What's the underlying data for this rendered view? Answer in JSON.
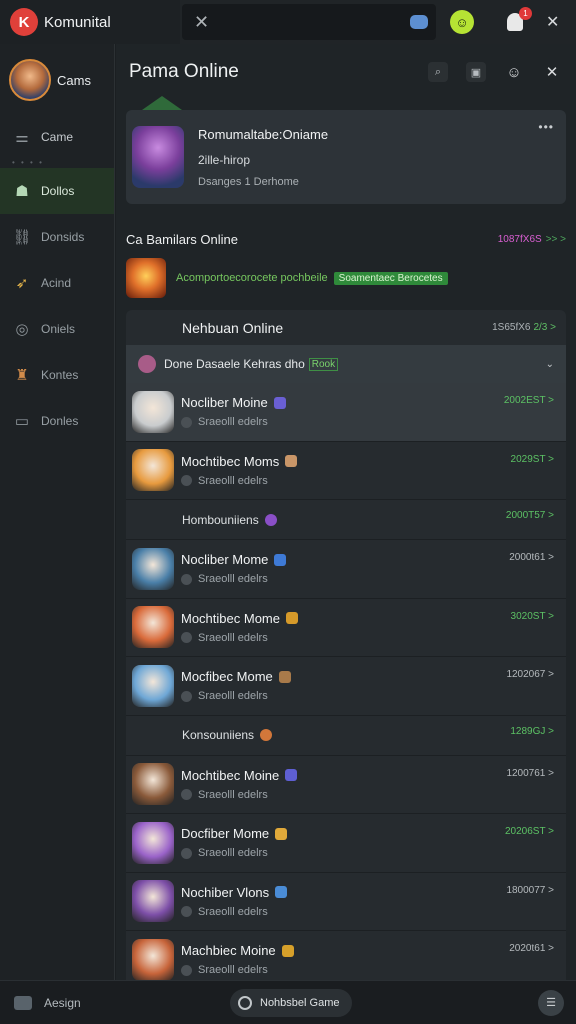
{
  "app": {
    "brand": "Komunital",
    "brand_logo": "K"
  },
  "topbar": {
    "search_close": "✕",
    "badge": "1",
    "close": "✕"
  },
  "sidebar": {
    "profile_label": "Cams",
    "items": [
      {
        "label": "Came",
        "icon": "controller-icon"
      },
      {
        "label": "Dollos",
        "icon": "chat-icon",
        "active": true
      },
      {
        "label": "Donsids",
        "icon": "link-icon"
      },
      {
        "label": "Acind",
        "icon": "rocket-icon"
      },
      {
        "label": "Oniels",
        "icon": "shield-icon"
      },
      {
        "label": "Kontes",
        "icon": "character-icon"
      },
      {
        "label": "Donles",
        "icon": "box-icon"
      }
    ]
  },
  "main": {
    "title": "Pama Online",
    "featured": {
      "title": "Romumaltabe:Oniame",
      "subtitle": "2ille-hirop",
      "meta": "Dsanges 1 Derhome",
      "more": "•••"
    },
    "section1": {
      "title": "Ca Bamilars Online",
      "count": "1087fX6S",
      "count_arrow": ">> >",
      "link": "Acomportoecorocete pochbeile",
      "tag": "Soamentaec Berocetes"
    },
    "panel": {
      "title": "Nehbuan Online",
      "count": "1S65fX6",
      "count_green": "2/3 >",
      "subhead": {
        "label": "Done Dasaele Kehras dho",
        "tag": "Rook",
        "more": "⌄"
      }
    },
    "rows": [
      {
        "kind": "row",
        "name": "Nocliber Moine",
        "status": "Sraeolll edelrs",
        "count": "2002EST >",
        "count_color": "green",
        "highlight": true,
        "thumb": "#c9ccce",
        "emoji": "#6a5fd3"
      },
      {
        "kind": "row",
        "name": "Mochtibec Moms",
        "status": "Sraeolll edelrs",
        "count": "2029ST >",
        "count_color": "green",
        "thumb": "#e79a3e",
        "emoji": "#c99668"
      },
      {
        "kind": "group",
        "name": "Hombouniiens",
        "count": "2000T57 >",
        "icon": "#8a4fc7"
      },
      {
        "kind": "row",
        "name": "Nocliber Mome",
        "status": "Sraeolll edelrs",
        "count": "2000t61 >",
        "count_color": "gray",
        "thumb": "#4a7fa8",
        "emoji": "#3e7ad6"
      },
      {
        "kind": "row",
        "name": "Mochtibec Mome",
        "status": "Sraeolll edelrs",
        "count": "3020ST >",
        "count_color": "green",
        "thumb": "#d96a3a",
        "emoji": "#d69a2a"
      },
      {
        "kind": "row",
        "name": "Mocfibec Mome",
        "status": "Sraeolll edelrs",
        "count": "1202067 >",
        "count_color": "gray",
        "thumb": "#6ea7d6",
        "emoji": "#a87a4a"
      },
      {
        "kind": "group",
        "name": "Konsouniiens",
        "count": "1289GJ >",
        "icon": "#d2773a"
      },
      {
        "kind": "row",
        "name": "Mochtibec Moine",
        "status": "Sraeolll edelrs",
        "count": "1200761 >",
        "count_color": "gray",
        "thumb": "#8a5a3a",
        "emoji": "#5e5fd3"
      },
      {
        "kind": "row",
        "name": "Docfiber Mome",
        "status": "Sraeolll edelrs",
        "count": "20206ST >",
        "count_color": "green",
        "thumb": "#9a63c9",
        "emoji": "#e0a93a"
      },
      {
        "kind": "row",
        "name": "Nochiber Vlons",
        "status": "Sraeolll edelrs",
        "count": "1800077 >",
        "count_color": "gray",
        "thumb": "#7d4fa8",
        "emoji": "#4a8cd6"
      },
      {
        "kind": "row",
        "name": "Machbiec Moine",
        "status": "Sraeolll edelrs",
        "count": "2020t61 >",
        "count_color": "gray",
        "thumb": "#c7643a",
        "emoji": "#d6a02a"
      }
    ]
  },
  "bottombar": {
    "left_label": "Aesign",
    "pill_label": "Nohbsbel Game",
    "right_icon": "☰"
  }
}
